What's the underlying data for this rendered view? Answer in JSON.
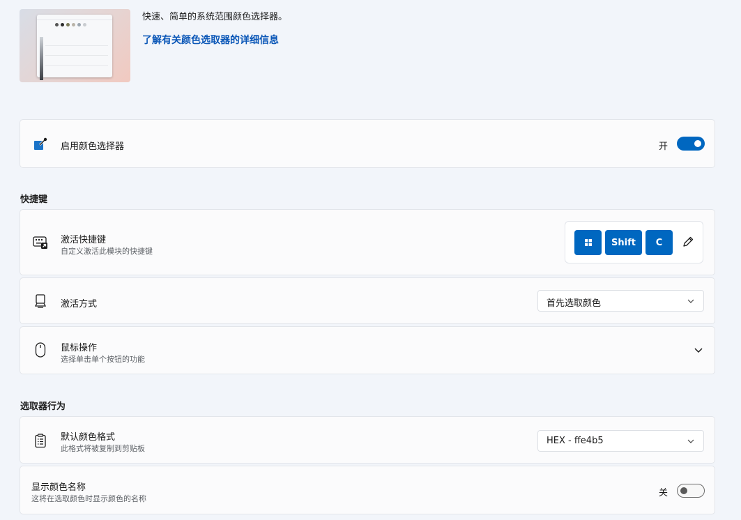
{
  "hero": {
    "description": "快速、简单的系统范围颜色选择器。",
    "link": "了解有关颜色选取器的详细信息"
  },
  "enable": {
    "label": "启用颜色选择器",
    "state": "开",
    "on": true
  },
  "shortcuts": {
    "heading": "快捷键",
    "activation_shortcut": {
      "title": "激活快捷键",
      "subtitle": "自定义激活此模块的快捷键",
      "keys": [
        "windows-key-icon",
        "Shift",
        "C"
      ]
    },
    "activation_method": {
      "title": "激活方式",
      "value": "首先选取颜色"
    },
    "mouse_actions": {
      "title": "鼠标操作",
      "subtitle": "选择单击单个按钮的功能"
    }
  },
  "picker_behavior": {
    "heading": "选取器行为",
    "default_format": {
      "title": "默认颜色格式",
      "subtitle": "此格式将被复制到剪贴板",
      "value": "HEX - ffe4b5"
    },
    "show_name": {
      "title": "显示颜色名称",
      "subtitle": "这将在选取颜色时显示颜色的名称",
      "state": "关",
      "on": false
    }
  },
  "colors": {
    "accent": "#0067c0",
    "link": "#0b57b7",
    "background": "#f2f5fa",
    "card": "#fbfbfc"
  }
}
